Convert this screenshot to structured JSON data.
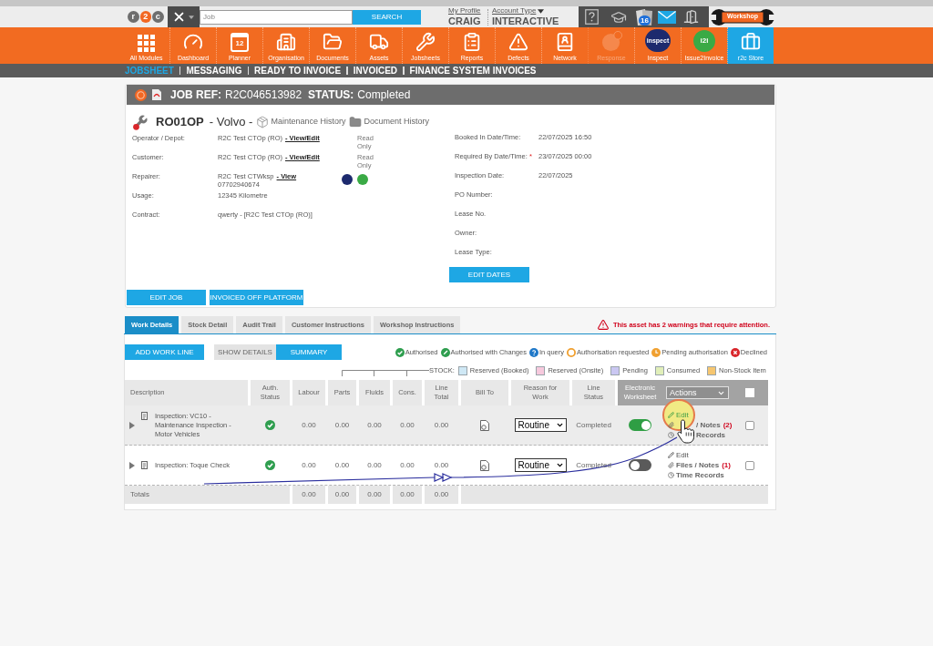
{
  "header": {
    "logo": [
      "r",
      "2",
      "c"
    ],
    "search": {
      "placeholder": "Job",
      "button": "SEARCH"
    },
    "profile": {
      "link": "My Profile",
      "name": "CRAIG"
    },
    "account": {
      "link": "Account Type",
      "value": "INTERACTIVE"
    },
    "notification_count": "16",
    "workshop_logo": "Workshop"
  },
  "modules": [
    {
      "kind": "grid",
      "label": "All Modules",
      "selected": false,
      "disabled": false
    },
    {
      "kind": "gauge",
      "label": "Dashboard",
      "selected": false,
      "disabled": false
    },
    {
      "kind": "calendar",
      "label": "Planner",
      "icon_text": "12",
      "selected": false,
      "disabled": false
    },
    {
      "kind": "buildings",
      "label": "Organisation",
      "selected": false,
      "disabled": false
    },
    {
      "kind": "folder",
      "label": "Documents",
      "selected": false,
      "disabled": false
    },
    {
      "kind": "truck",
      "label": "Assets",
      "selected": false,
      "disabled": false
    },
    {
      "kind": "tools",
      "label": "Jobsheets",
      "selected": false,
      "disabled": false
    },
    {
      "kind": "clipboard",
      "label": "Reports",
      "selected": false,
      "disabled": false
    },
    {
      "kind": "warning",
      "label": "Defects",
      "selected": false,
      "disabled": false
    },
    {
      "kind": "contacts",
      "label": "Network",
      "selected": false,
      "disabled": false
    },
    {
      "kind": "response",
      "label": "Response",
      "selected": false,
      "disabled": true
    },
    {
      "kind": "inspect",
      "label": "Inspect",
      "icon_text": "inspect",
      "selected": false,
      "disabled": false
    },
    {
      "kind": "i2i",
      "label": "Issue2Invoice",
      "icon_text": "i2i",
      "selected": false,
      "disabled": false
    },
    {
      "kind": "briefcase",
      "label": "r2c Store",
      "selected": true,
      "disabled": false
    }
  ],
  "subnav": [
    {
      "label": "JOBSHEET",
      "selected": true
    },
    {
      "label": "MESSAGING",
      "selected": false
    },
    {
      "label": "READY TO INVOICE",
      "selected": false
    },
    {
      "label": "INVOICED",
      "selected": false
    },
    {
      "label": "FINANCE SYSTEM INVOICES",
      "selected": false
    }
  ],
  "job": {
    "ref_label": "JOB REF:",
    "ref": "R2C046513982",
    "status_label": "STATUS:",
    "status": "Completed",
    "vehicle": {
      "reg": "RO01OP",
      "make": "- Volvo -",
      "links": [
        {
          "kind": "maintenance",
          "label": "Maintenance History"
        },
        {
          "kind": "documents",
          "label": "Document History"
        }
      ]
    },
    "left_fields": [
      {
        "label": "Operator / Depot:",
        "value": "R2C Test CTOp (RO)",
        "link": "- View/Edit",
        "note": "Read Only"
      },
      {
        "label": "Customer:",
        "value": "R2C Test CTOp (RO)",
        "link": "- View/Edit",
        "note": "Read Only"
      },
      {
        "label": "Repairer:",
        "value": "R2C Test CTWksp",
        "link": "- View",
        "phone": "07702940674",
        "app_icons": [
          {
            "kind": "inspect"
          },
          {
            "kind": "i2i"
          }
        ]
      },
      {
        "label": "Usage:",
        "value": "12345 Kilometre"
      },
      {
        "label": "Contract:",
        "value": "qwerty - [R2C Test CTOp (RO)]"
      }
    ],
    "right_fields": [
      {
        "label": "Booked In Date/Time:",
        "value": "22/07/2025 16:50"
      },
      {
        "label": "Required By Date/Time:",
        "required_mark": "*",
        "value": "23/07/2025 00:00"
      },
      {
        "label": "Inspection Date:",
        "value": "22/07/2025"
      },
      {
        "label": "PO Number:"
      },
      {
        "label": "Lease No."
      },
      {
        "label": "Owner:"
      },
      {
        "label": "Lease Type:"
      }
    ],
    "edit_dates": "EDIT DATES",
    "buttons": [
      "EDIT JOB",
      "INVOICED OFF PLATFORM"
    ]
  },
  "tabs": [
    {
      "label": "Work Details",
      "selected": true
    },
    {
      "label": "Stock Detail",
      "selected": false
    },
    {
      "label": "Audit Trail",
      "selected": false
    },
    {
      "label": "Customer Instructions",
      "selected": false
    },
    {
      "label": "Workshop Instructions",
      "selected": false
    }
  ],
  "warning": "This asset has 2 warnings that require attention.",
  "work": {
    "add_button": "ADD WORK LINE",
    "views": [
      {
        "label": "SHOW DETAILS",
        "selected": false
      },
      {
        "label": "SUMMARY",
        "selected": true
      }
    ],
    "auth_legend": [
      {
        "kind": "authorised",
        "label": "Authorised"
      },
      {
        "kind": "changes",
        "label": "Authorised with Changes"
      },
      {
        "kind": "query",
        "label": "In query"
      },
      {
        "kind": "requested",
        "label": "Authorisation requested"
      },
      {
        "kind": "pending",
        "label": "Pending authorisation"
      },
      {
        "kind": "declined",
        "label": "Declined"
      }
    ],
    "stock_legend": {
      "label": "STOCK:",
      "items": [
        {
          "label": "Reserved (Booked)",
          "color": "#cfe8f5"
        },
        {
          "label": "Reserved (Onsite)",
          "color": "#f7c9dd"
        },
        {
          "label": "Pending",
          "color": "#cac7f2"
        },
        {
          "label": "Consumed",
          "color": "#e1efb9"
        },
        {
          "label": "Non-Stock Item",
          "color": "#f6c670"
        }
      ]
    },
    "columns": [
      "Description",
      "Auth. Status",
      "Labour",
      "Parts",
      "Fluids",
      "Cons.",
      "Line Total",
      "Bill To",
      "Reason for Work",
      "Line Status",
      "Electronic Worksheet"
    ],
    "actions_select": "Actions",
    "select_all": false,
    "rows": [
      {
        "hovered": true,
        "description": "Inspection: VC10 - Maintenance Inspection - Motor Vehicles",
        "auth": {
          "kind": "authorised"
        },
        "amounts": [
          "0.00",
          "0.00",
          "0.00",
          "0.00",
          "0.00"
        ],
        "reason": "Routine",
        "status": "Completed",
        "worksheet_on": true,
        "pointer": true,
        "checked": false,
        "actions": [
          {
            "kind": "edit",
            "label": "Edit",
            "highlighted": true
          },
          {
            "kind": "files",
            "label": "/ Notes",
            "count": "(2)"
          },
          {
            "kind": "time",
            "label": "Records"
          }
        ]
      },
      {
        "hovered": false,
        "description": "Inspection: Toque Check",
        "auth": {
          "kind": "authorised"
        },
        "amounts": [
          "0.00",
          "0.00",
          "0.00",
          "0.00",
          "0.00"
        ],
        "reason": "Routine",
        "status": "Completed",
        "worksheet_on": false,
        "pointer": false,
        "checked": false,
        "actions": [
          {
            "kind": "edit",
            "label": "Edit",
            "highlighted": false
          },
          {
            "kind": "files",
            "label": "Files / Notes",
            "count": "(1)"
          },
          {
            "kind": "time",
            "label": "Time Records"
          }
        ]
      }
    ],
    "totals": {
      "label": "Totals",
      "values": [
        "0.00",
        "0.00",
        "0.00",
        "0.00",
        "0.00"
      ]
    },
    "annotation_arrow": true
  }
}
